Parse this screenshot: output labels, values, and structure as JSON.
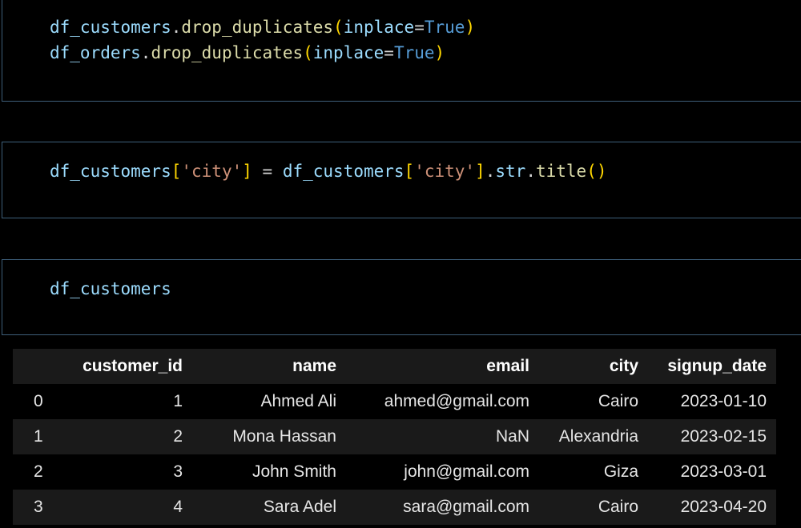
{
  "cells": [
    {
      "lines": [
        [
          {
            "t": "df_customers",
            "c": "var"
          },
          {
            "t": ".",
            "c": "punc"
          },
          {
            "t": "drop_duplicates",
            "c": "fn"
          },
          {
            "t": "(",
            "c": "paren"
          },
          {
            "t": "inplace",
            "c": "var"
          },
          {
            "t": "=",
            "c": "punc"
          },
          {
            "t": "True",
            "c": "kw"
          },
          {
            "t": ")",
            "c": "paren"
          }
        ],
        [
          {
            "t": "df_orders",
            "c": "var"
          },
          {
            "t": ".",
            "c": "punc"
          },
          {
            "t": "drop_duplicates",
            "c": "fn"
          },
          {
            "t": "(",
            "c": "paren"
          },
          {
            "t": "inplace",
            "c": "var"
          },
          {
            "t": "=",
            "c": "punc"
          },
          {
            "t": "True",
            "c": "kw"
          },
          {
            "t": ")",
            "c": "paren"
          }
        ]
      ]
    },
    {
      "lines": [
        [
          {
            "t": "df_customers",
            "c": "var"
          },
          {
            "t": "[",
            "c": "bracket"
          },
          {
            "t": "'city'",
            "c": "str"
          },
          {
            "t": "]",
            "c": "bracket"
          },
          {
            "t": " = ",
            "c": "punc"
          },
          {
            "t": "df_customers",
            "c": "var"
          },
          {
            "t": "[",
            "c": "bracket"
          },
          {
            "t": "'city'",
            "c": "str"
          },
          {
            "t": "]",
            "c": "bracket"
          },
          {
            "t": ".",
            "c": "punc"
          },
          {
            "t": "str",
            "c": "var"
          },
          {
            "t": ".",
            "c": "punc"
          },
          {
            "t": "title",
            "c": "fn"
          },
          {
            "t": "()",
            "c": "paren"
          }
        ]
      ]
    },
    {
      "lines": [
        [
          {
            "t": "df_customers",
            "c": "var"
          }
        ]
      ]
    }
  ],
  "table": {
    "columns": [
      "customer_id",
      "name",
      "email",
      "city",
      "signup_date"
    ],
    "rows": [
      {
        "index": "0",
        "customer_id": "1",
        "name": "Ahmed Ali",
        "email": "ahmed@gmail.com",
        "city": "Cairo",
        "signup_date": "2023-01-10"
      },
      {
        "index": "1",
        "customer_id": "2",
        "name": "Mona Hassan",
        "email": "NaN",
        "city": "Alexandria",
        "signup_date": "2023-02-15"
      },
      {
        "index": "2",
        "customer_id": "3",
        "name": "John Smith",
        "email": "john@gmail.com",
        "city": "Giza",
        "signup_date": "2023-03-01"
      },
      {
        "index": "3",
        "customer_id": "4",
        "name": "Sara Adel",
        "email": "sara@gmail.com",
        "city": "Cairo",
        "signup_date": "2023-04-20"
      }
    ]
  }
}
